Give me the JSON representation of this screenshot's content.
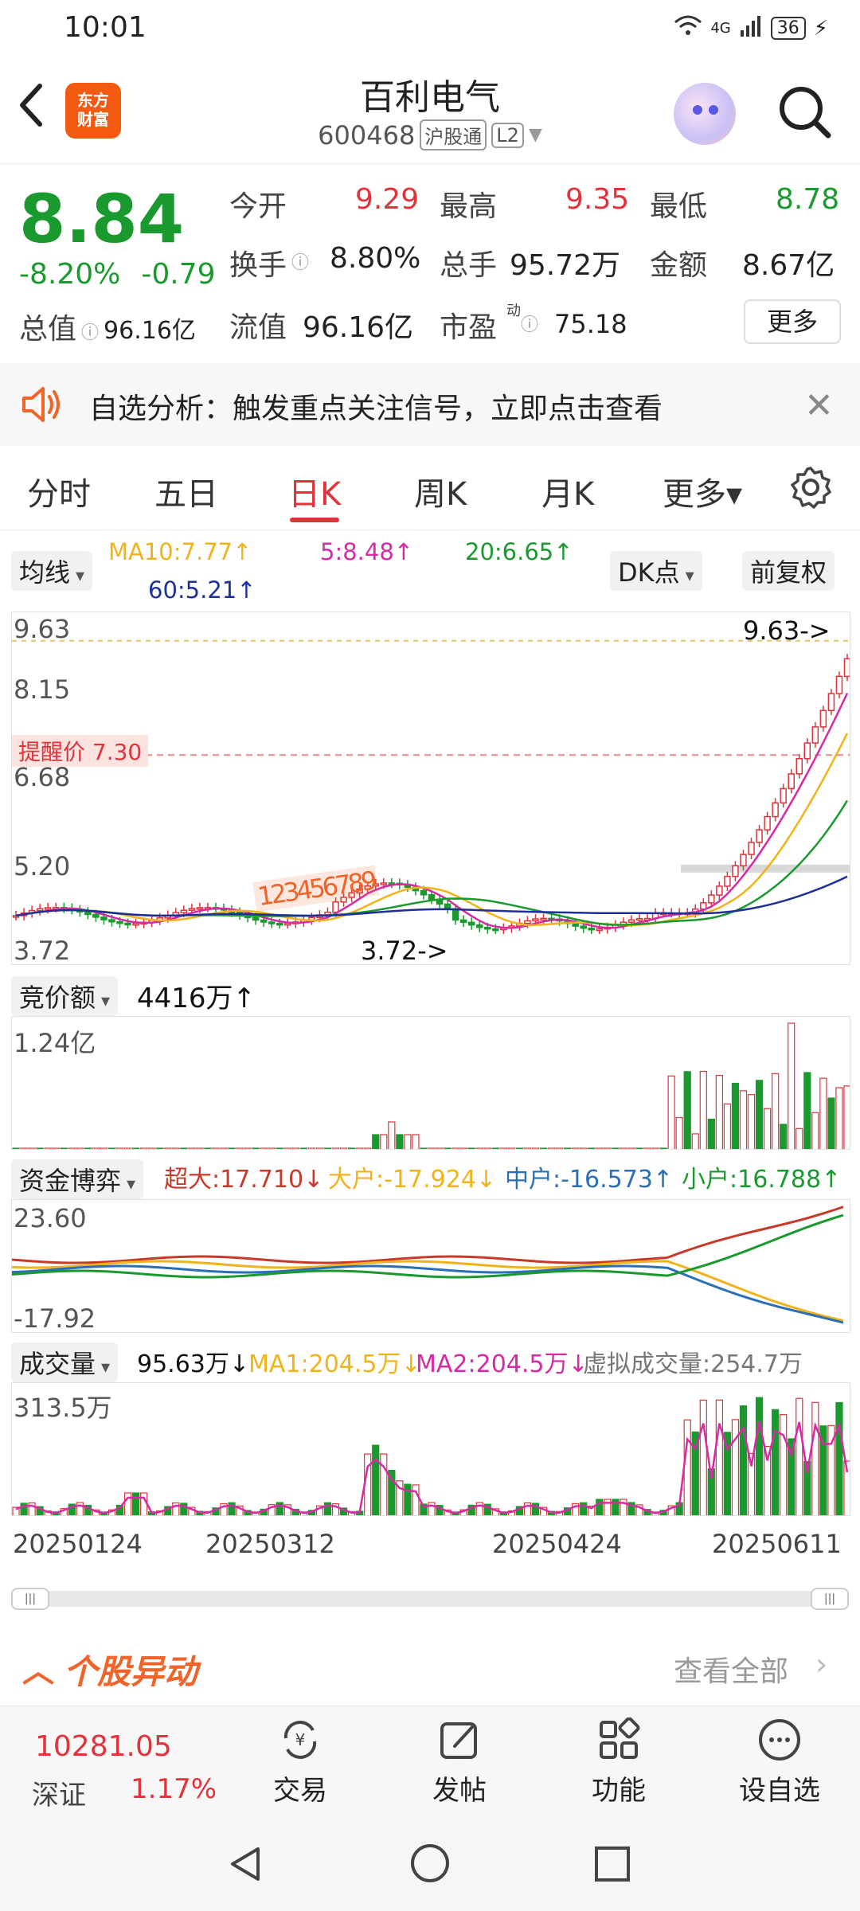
{
  "status_bar": {
    "time": "10:01",
    "network": "4G",
    "battery": "36"
  },
  "header": {
    "brand_logo_text": "东方\n财富",
    "stock_name": "百利电气",
    "stock_code": "600468",
    "tag_connect": "沪股通",
    "tag_level": "L2"
  },
  "quote": {
    "last_price": "8.84",
    "change_pct": "-8.20%",
    "change_amt": "-0.79",
    "open_label": "今开",
    "open_value": "9.29",
    "high_label": "最高",
    "high_value": "9.35",
    "low_label": "最低",
    "low_value": "8.78",
    "turnover_label": "换手",
    "turnover_value": "8.80%",
    "volume_label": "总手",
    "volume_value": "95.72万",
    "amount_label": "金额",
    "amount_value": "8.67亿",
    "total_cap_label": "总值",
    "total_cap_value": "96.16亿",
    "float_cap_label": "流值",
    "float_cap_value": "96.16亿",
    "pe_label": "市盈",
    "pe_sup": "动",
    "pe_value": "75.18",
    "more_label": "更多"
  },
  "alert": {
    "text": "自选分析：触发重点关注信号，立即点击查看"
  },
  "tabs": [
    {
      "label": "分时"
    },
    {
      "label": "五日"
    },
    {
      "label": "日K"
    },
    {
      "label": "周K"
    },
    {
      "label": "月K"
    },
    {
      "label": "更多▾"
    }
  ],
  "kline_controls": {
    "indicator": "均线",
    "ma10": "MA10:7.77↑",
    "ma5": "5:8.48↑",
    "ma20": "20:6.65↑",
    "ma60": "60:5.21↑",
    "dk_label": "DK点",
    "adjust_label": "前复权"
  },
  "colors": {
    "up": "#e4323b",
    "down": "#1a9a2e",
    "ma5": "#d62aa6",
    "ma10": "#f2b31a",
    "ma20": "#1a9a2e",
    "ma60": "#1e2f9c"
  },
  "chart_data": [
    {
      "type": "candlestick",
      "title": "日K",
      "y_labels": [
        "9.63",
        "8.15",
        "6.68",
        "5.20",
        "3.72"
      ],
      "ylim": [
        3.72,
        9.63
      ],
      "alert_price_label": "提醒价 7.30",
      "alert_price": 7.3,
      "max_marker": "9.63->",
      "min_marker": "3.72->",
      "signal_digits": "123456789",
      "x_labels": [
        "20250124",
        "20250312",
        "20250424",
        "20250611"
      ],
      "ma": [
        {
          "name": "MA5",
          "value": 8.48
        },
        {
          "name": "MA10",
          "value": 7.77
        },
        {
          "name": "MA20",
          "value": 6.65
        },
        {
          "name": "MA60",
          "value": 5.21
        }
      ]
    },
    {
      "type": "bar",
      "title": "竞价额",
      "legend": "4416万↑",
      "y_max_label": "1.24亿"
    },
    {
      "type": "line",
      "title": "资金博弈",
      "y_labels": [
        "23.60",
        "-17.92"
      ],
      "series": [
        {
          "name": "超大",
          "value": 17.71,
          "label": "超大:17.710↓"
        },
        {
          "name": "大户",
          "value": -17.924,
          "label": "大户:-17.924↓"
        },
        {
          "name": "中户",
          "value": -16.573,
          "label": "中户:-16.573↑"
        },
        {
          "name": "小户",
          "value": 16.788,
          "label": "小户:16.788↑"
        }
      ]
    },
    {
      "type": "bar",
      "title": "成交量",
      "legend_value": "95.63万↓",
      "ma1": "MA1:204.5万↓",
      "ma2": "MA2:204.5万↓",
      "virtual_volume": "虚拟成交量:254.7万",
      "y_max_label": "313.5万"
    }
  ],
  "stock_activity": {
    "title": "个股异动",
    "view_all": "查看全部"
  },
  "bottom_nav": {
    "index_value": "10281.05",
    "index_name": "深证",
    "index_change": "1.17%",
    "items": [
      {
        "label": "交易"
      },
      {
        "label": "发帖"
      },
      {
        "label": "功能"
      },
      {
        "label": "设自选"
      }
    ]
  }
}
